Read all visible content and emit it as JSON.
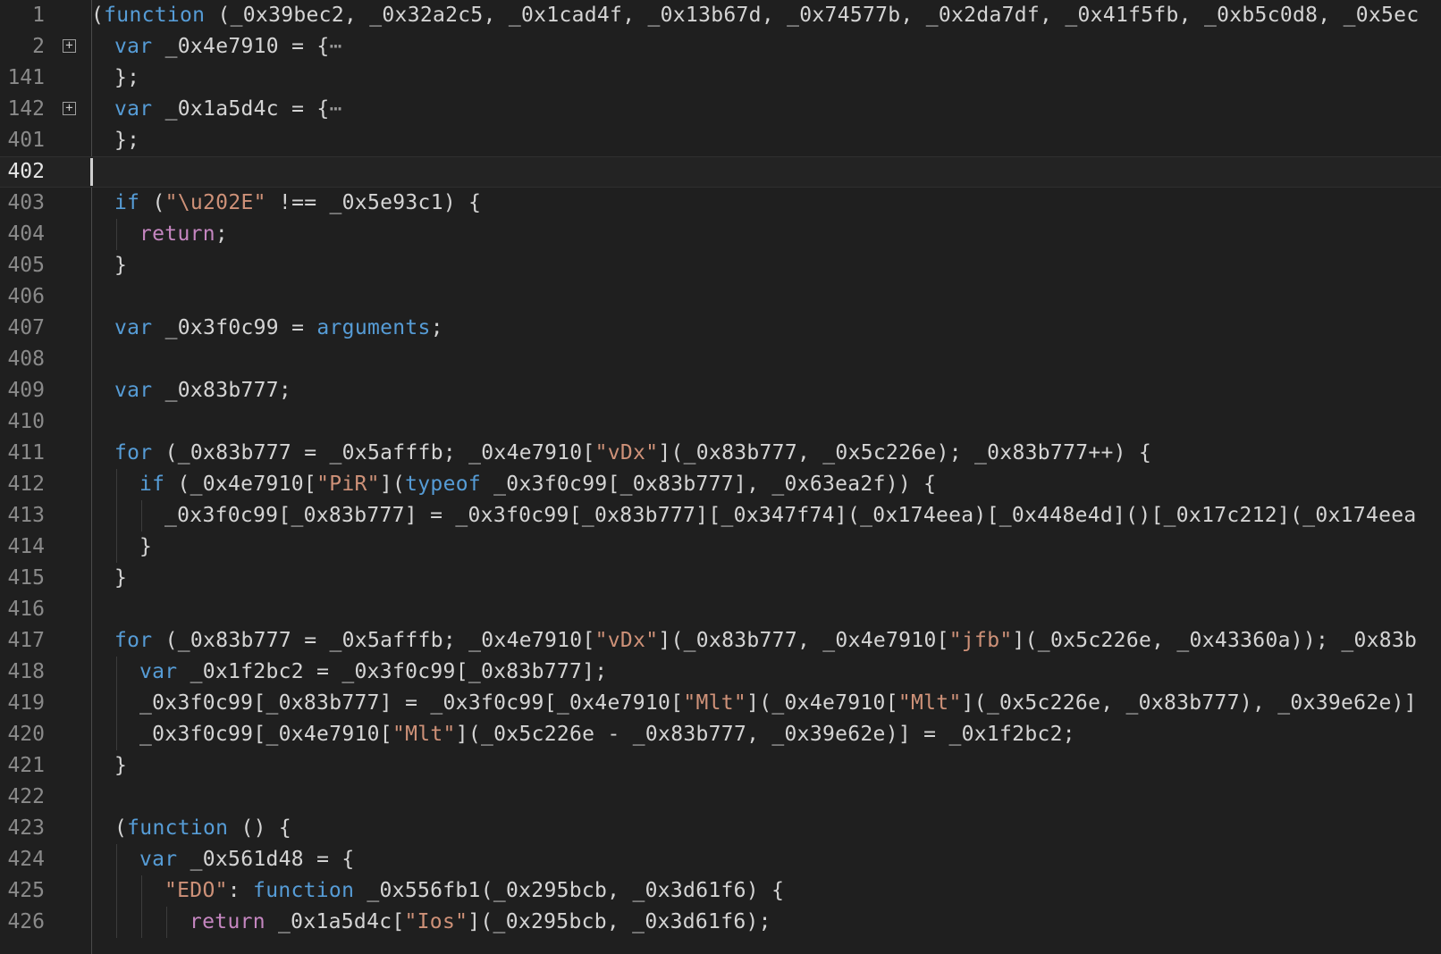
{
  "editor": {
    "theme_colors": {
      "background": "#1f1f1f",
      "keyword": "#569cd6",
      "control": "#c586c0",
      "string": "#ce9178",
      "text": "#d4d4d4",
      "line_number": "#8a8a8a"
    },
    "current_line": "402",
    "fold_icon": "plus-square-icon",
    "lines": [
      {
        "num": "1",
        "indent": 0,
        "fold": false,
        "tokens": [
          [
            "p",
            "("
          ],
          [
            "kw",
            "function"
          ],
          [
            "p",
            " (_0x39bec2, _0x32a2c5, _0x1cad4f, _0x13b67d, _0x74577b, _0x2da7df, _0x41f5fb, _0xb5c0d8, _0x5ec"
          ]
        ]
      },
      {
        "num": "2",
        "indent": 1,
        "fold": true,
        "tokens": [
          [
            "kw",
            "var"
          ],
          [
            "p",
            " _0x4e7910 = {"
          ],
          [
            "el",
            "⋯"
          ]
        ]
      },
      {
        "num": "141",
        "indent": 1,
        "fold": false,
        "tokens": [
          [
            "p",
            "};"
          ]
        ]
      },
      {
        "num": "142",
        "indent": 1,
        "fold": true,
        "tokens": [
          [
            "kw",
            "var"
          ],
          [
            "p",
            " _0x1a5d4c = {"
          ],
          [
            "el",
            "⋯"
          ]
        ]
      },
      {
        "num": "401",
        "indent": 1,
        "fold": false,
        "tokens": [
          [
            "p",
            "};"
          ]
        ]
      },
      {
        "num": "402",
        "indent": 1,
        "fold": false,
        "tokens": []
      },
      {
        "num": "403",
        "indent": 1,
        "fold": false,
        "tokens": [
          [
            "kw",
            "if"
          ],
          [
            "p",
            " ("
          ],
          [
            "s",
            "\"\\u202E\""
          ],
          [
            "p",
            " !== _0x5e93c1) {"
          ]
        ]
      },
      {
        "num": "404",
        "indent": 2,
        "fold": false,
        "tokens": [
          [
            "c",
            "return"
          ],
          [
            "p",
            ";"
          ]
        ]
      },
      {
        "num": "405",
        "indent": 1,
        "fold": false,
        "tokens": [
          [
            "p",
            "}"
          ]
        ]
      },
      {
        "num": "406",
        "indent": 1,
        "fold": false,
        "tokens": []
      },
      {
        "num": "407",
        "indent": 1,
        "fold": false,
        "tokens": [
          [
            "kw",
            "var"
          ],
          [
            "p",
            " _0x3f0c99 = "
          ],
          [
            "kw",
            "arguments"
          ],
          [
            "p",
            ";"
          ]
        ]
      },
      {
        "num": "408",
        "indent": 1,
        "fold": false,
        "tokens": []
      },
      {
        "num": "409",
        "indent": 1,
        "fold": false,
        "tokens": [
          [
            "kw",
            "var"
          ],
          [
            "p",
            " _0x83b777;"
          ]
        ]
      },
      {
        "num": "410",
        "indent": 1,
        "fold": false,
        "tokens": []
      },
      {
        "num": "411",
        "indent": 1,
        "fold": false,
        "tokens": [
          [
            "kw",
            "for"
          ],
          [
            "p",
            " (_0x83b777 = _0x5afffb; _0x4e7910["
          ],
          [
            "s",
            "\"vDx\""
          ],
          [
            "p",
            "](_0x83b777, _0x5c226e); _0x83b777++) {"
          ]
        ]
      },
      {
        "num": "412",
        "indent": 2,
        "fold": false,
        "tokens": [
          [
            "kw",
            "if"
          ],
          [
            "p",
            " (_0x4e7910["
          ],
          [
            "s",
            "\"PiR\""
          ],
          [
            "p",
            "]("
          ],
          [
            "kw",
            "typeof"
          ],
          [
            "p",
            " _0x3f0c99[_0x83b777], _0x63ea2f)) {"
          ]
        ]
      },
      {
        "num": "413",
        "indent": 3,
        "fold": false,
        "tokens": [
          [
            "p",
            "_0x3f0c99[_0x83b777] = _0x3f0c99[_0x83b777][_0x347f74](_0x174eea)[_0x448e4d]()[_0x17c212](_0x174eea"
          ]
        ]
      },
      {
        "num": "414",
        "indent": 2,
        "fold": false,
        "tokens": [
          [
            "p",
            "}"
          ]
        ]
      },
      {
        "num": "415",
        "indent": 1,
        "fold": false,
        "tokens": [
          [
            "p",
            "}"
          ]
        ]
      },
      {
        "num": "416",
        "indent": 1,
        "fold": false,
        "tokens": []
      },
      {
        "num": "417",
        "indent": 1,
        "fold": false,
        "tokens": [
          [
            "kw",
            "for"
          ],
          [
            "p",
            " (_0x83b777 = _0x5afffb; _0x4e7910["
          ],
          [
            "s",
            "\"vDx\""
          ],
          [
            "p",
            "](_0x83b777, _0x4e7910["
          ],
          [
            "s",
            "\"jfb\""
          ],
          [
            "p",
            "](_0x5c226e, _0x43360a)); _0x83b"
          ]
        ]
      },
      {
        "num": "418",
        "indent": 2,
        "fold": false,
        "tokens": [
          [
            "kw",
            "var"
          ],
          [
            "p",
            " _0x1f2bc2 = _0x3f0c99[_0x83b777];"
          ]
        ]
      },
      {
        "num": "419",
        "indent": 2,
        "fold": false,
        "tokens": [
          [
            "p",
            "_0x3f0c99[_0x83b777] = _0x3f0c99[_0x4e7910["
          ],
          [
            "s",
            "\"Mlt\""
          ],
          [
            "p",
            "](_0x4e7910["
          ],
          [
            "s",
            "\"Mlt\""
          ],
          [
            "p",
            "](_0x5c226e, _0x83b777), _0x39e62e)]"
          ]
        ]
      },
      {
        "num": "420",
        "indent": 2,
        "fold": false,
        "tokens": [
          [
            "p",
            "_0x3f0c99[_0x4e7910["
          ],
          [
            "s",
            "\"Mlt\""
          ],
          [
            "p",
            "](_0x5c226e - _0x83b777, _0x39e62e)] = _0x1f2bc2;"
          ]
        ]
      },
      {
        "num": "421",
        "indent": 1,
        "fold": false,
        "tokens": [
          [
            "p",
            "}"
          ]
        ]
      },
      {
        "num": "422",
        "indent": 1,
        "fold": false,
        "tokens": []
      },
      {
        "num": "423",
        "indent": 1,
        "fold": false,
        "tokens": [
          [
            "p",
            "("
          ],
          [
            "kw",
            "function"
          ],
          [
            "p",
            " () {"
          ]
        ]
      },
      {
        "num": "424",
        "indent": 2,
        "fold": false,
        "tokens": [
          [
            "kw",
            "var"
          ],
          [
            "p",
            " _0x561d48 = {"
          ]
        ]
      },
      {
        "num": "425",
        "indent": 3,
        "fold": false,
        "tokens": [
          [
            "s",
            "\"EDO\""
          ],
          [
            "p",
            ": "
          ],
          [
            "kw",
            "function"
          ],
          [
            "p",
            " _0x556fb1(_0x295bcb, _0x3d61f6) {"
          ]
        ]
      },
      {
        "num": "426",
        "indent": 4,
        "fold": false,
        "tokens": [
          [
            "c",
            "return"
          ],
          [
            "p",
            " _0x1a5d4c["
          ],
          [
            "s",
            "\"Ios\""
          ],
          [
            "p",
            "](_0x295bcb, _0x3d61f6);"
          ]
        ]
      }
    ]
  }
}
